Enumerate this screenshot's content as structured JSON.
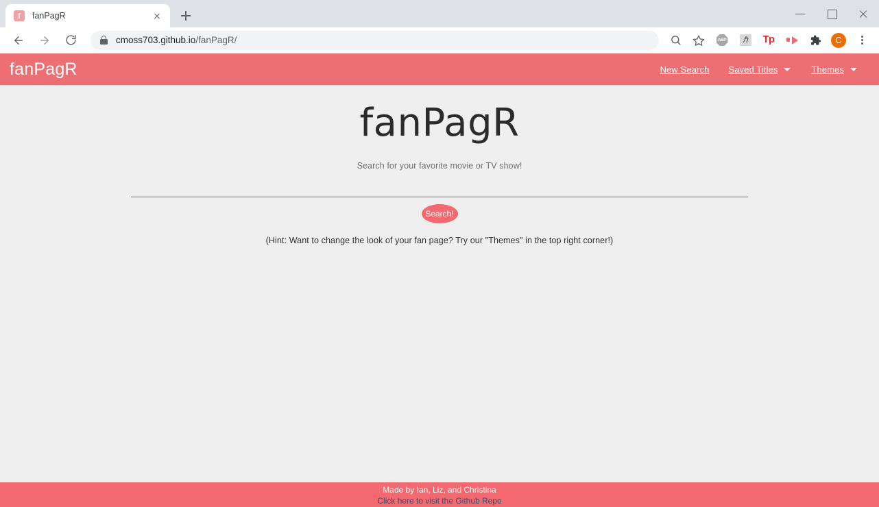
{
  "browser": {
    "tab": {
      "title": "fanPagR",
      "favicon_letter": "f",
      "favicon_name": "fanpagr-favicon",
      "close_icon": "close-icon"
    },
    "new_tab_icon": "plus-icon",
    "window_controls": {
      "minimize": "minimize-icon",
      "maximize": "maximize-icon",
      "close": "close-icon"
    },
    "toolbar": {
      "back_icon": "back-arrow-icon",
      "forward_icon": "forward-arrow-icon",
      "reload_icon": "reload-icon",
      "lock_icon": "lock-icon",
      "url_host": "cmoss703.github.io",
      "url_path": "/fanPagR/",
      "url_full": "cmoss703.github.io/fanPagR/",
      "icons": [
        {
          "name": "zoom-search-icon",
          "label": ""
        },
        {
          "name": "bookmark-star-icon",
          "label": ""
        },
        {
          "name": "adblock-plus-extension-icon",
          "label": "ABP"
        },
        {
          "name": "honey-extension-icon",
          "label": "ℏ"
        },
        {
          "name": "toolpages-extension-icon",
          "label": "Tp"
        },
        {
          "name": "video-downloader-extension-icon",
          "label": ""
        },
        {
          "name": "extensions-puzzle-icon",
          "label": ""
        },
        {
          "name": "profile-avatar",
          "label": "C"
        },
        {
          "name": "chrome-menu-kebab-icon",
          "label": ""
        }
      ]
    }
  },
  "site": {
    "navbar": {
      "brand": "fanPagR",
      "links": [
        {
          "label": "New Search",
          "dropdown": false
        },
        {
          "label": "Saved Titles",
          "dropdown": true
        },
        {
          "label": "Themes",
          "dropdown": true
        }
      ]
    },
    "hero": {
      "title": "fanPagR",
      "subtitle": "Search for your favorite movie or TV show!"
    },
    "search": {
      "value": "",
      "placeholder": "",
      "button_label": "Search!"
    },
    "hint": "(Hint: Want to change the look of your fan page? Try our \"Themes\" in the top right corner!)",
    "footer": {
      "credit": "Made by Ian, Liz, and Christina",
      "repo_link": "Click here to visit the Github Repo"
    },
    "colors": {
      "accent": "#EE6F73",
      "accent_button": "#F4696F",
      "page_bg": "#EFEFEF",
      "footer_link": "#2F4F6F"
    }
  }
}
